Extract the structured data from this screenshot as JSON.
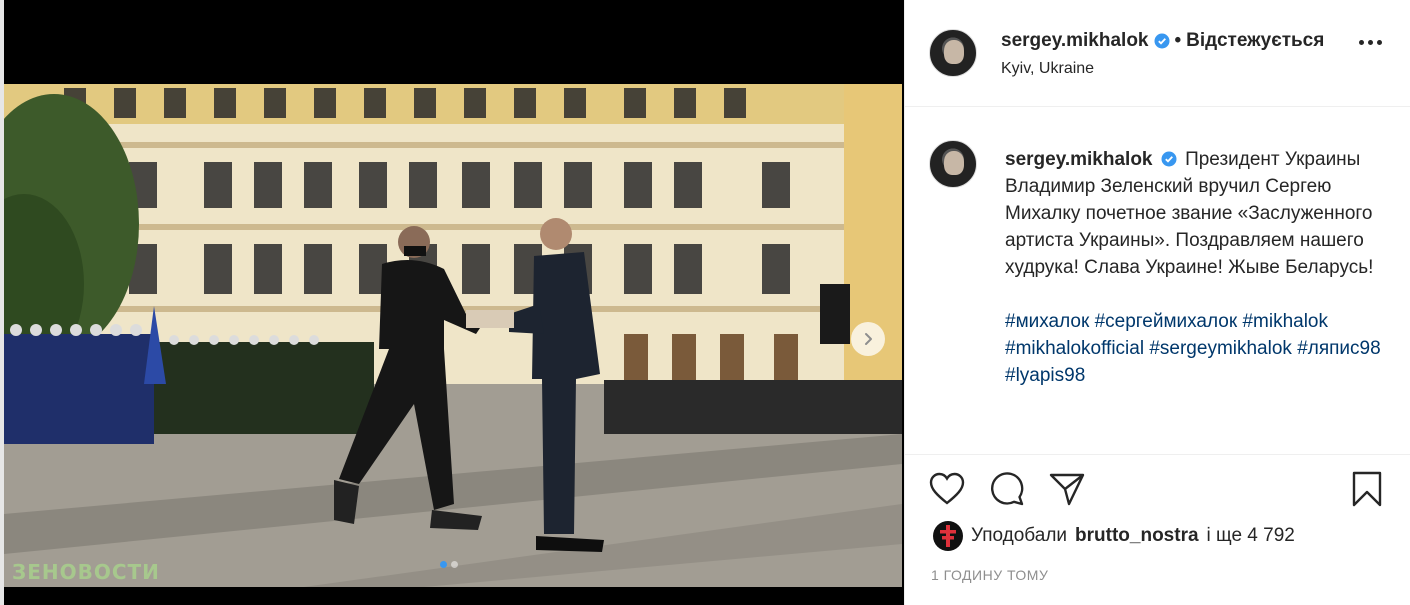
{
  "post": {
    "watermark": "ЗЕНОВОСТИ",
    "carousel": {
      "slide_count": 2,
      "active_index": 0
    }
  },
  "header": {
    "username": "sergey.mikhalok",
    "separator": "•",
    "follow_status": "Відстежується",
    "location": "Kyiv, Ukraine"
  },
  "caption": {
    "username": "sergey.mikhalok",
    "text": "Президент Украины Владимир Зеленский вручил Сергею Михалку почетное звание «Заслуженного артиста Украины». Поздравляем нашего худрука! Слава Украине! Жыве Беларусь!",
    "hashtags": [
      "#михалок",
      "#сергеймихалок",
      "#mikhalok",
      "#mikhalokofficial",
      "#sergeymikhalok",
      "#ляпис98",
      "#lyapis98"
    ]
  },
  "likes": {
    "prefix": "Уподобали",
    "user": "brutto_nostra",
    "suffix": "і ще 4 792"
  },
  "timestamp": "1 ГОДИНУ ТОМУ",
  "icons": {
    "like": "heart-icon",
    "comment": "comment-icon",
    "share": "paper-plane-icon",
    "save": "bookmark-icon",
    "verified": "verified-badge-icon",
    "more": "more-options-icon",
    "next": "chevron-right-icon"
  },
  "colors": {
    "verified": "#3897f0",
    "hashtag": "#00376b",
    "muted": "#8e8e8e",
    "active_dot": "#3897f0"
  }
}
